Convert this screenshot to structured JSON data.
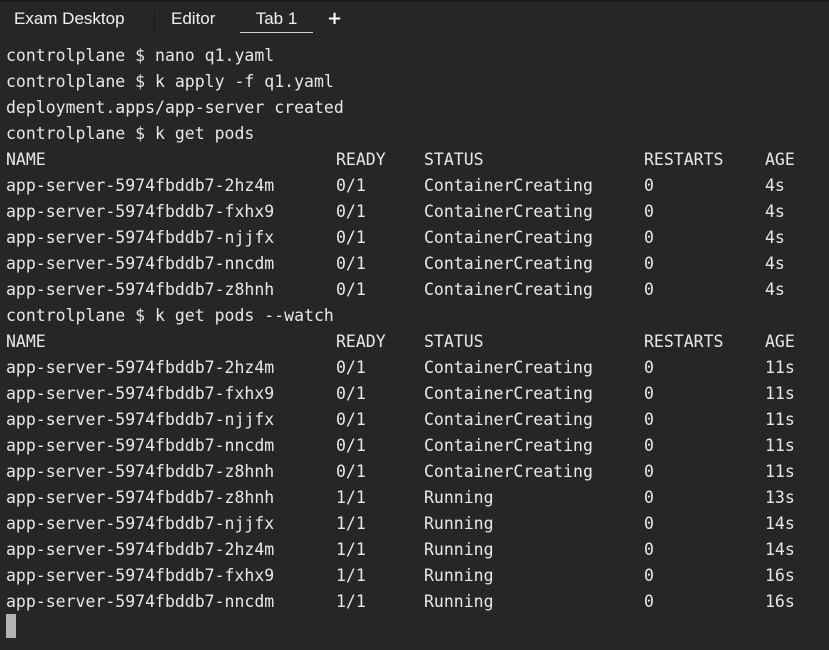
{
  "tabs": {
    "exam_desktop": "Exam Desktop",
    "editor": "Editor",
    "tab1": "Tab 1",
    "new_tab": "+"
  },
  "terminal": {
    "commands": [
      "controlplane $ nano q1.yaml",
      "controlplane $ k apply -f q1.yaml",
      "deployment.apps/app-server created",
      "controlplane $ k get pods",
      "controlplane $ k get pods --watch"
    ],
    "headers": [
      "NAME",
      "READY",
      "STATUS",
      "RESTARTS",
      "AGE"
    ],
    "get_pods_rows": [
      [
        "app-server-5974fbddb7-2hz4m",
        "0/1",
        "ContainerCreating",
        "0",
        "4s"
      ],
      [
        "app-server-5974fbddb7-fxhx9",
        "0/1",
        "ContainerCreating",
        "0",
        "4s"
      ],
      [
        "app-server-5974fbddb7-njjfx",
        "0/1",
        "ContainerCreating",
        "0",
        "4s"
      ],
      [
        "app-server-5974fbddb7-nncdm",
        "0/1",
        "ContainerCreating",
        "0",
        "4s"
      ],
      [
        "app-server-5974fbddb7-z8hnh",
        "0/1",
        "ContainerCreating",
        "0",
        "4s"
      ]
    ],
    "watch_rows": [
      [
        "app-server-5974fbddb7-2hz4m",
        "0/1",
        "ContainerCreating",
        "0",
        "11s"
      ],
      [
        "app-server-5974fbddb7-fxhx9",
        "0/1",
        "ContainerCreating",
        "0",
        "11s"
      ],
      [
        "app-server-5974fbddb7-njjfx",
        "0/1",
        "ContainerCreating",
        "0",
        "11s"
      ],
      [
        "app-server-5974fbddb7-nncdm",
        "0/1",
        "ContainerCreating",
        "0",
        "11s"
      ],
      [
        "app-server-5974fbddb7-z8hnh",
        "0/1",
        "ContainerCreating",
        "0",
        "11s"
      ],
      [
        "app-server-5974fbddb7-z8hnh",
        "1/1",
        "Running",
        "0",
        "13s"
      ],
      [
        "app-server-5974fbddb7-njjfx",
        "1/1",
        "Running",
        "0",
        "14s"
      ],
      [
        "app-server-5974fbddb7-2hz4m",
        "1/1",
        "Running",
        "0",
        "14s"
      ],
      [
        "app-server-5974fbddb7-fxhx9",
        "1/1",
        "Running",
        "0",
        "16s"
      ],
      [
        "app-server-5974fbddb7-nncdm",
        "1/1",
        "Running",
        "0",
        "16s"
      ]
    ]
  },
  "colors": {
    "background": "#262626",
    "text": "#e8e8e8",
    "cursor": "#b3b3b3"
  }
}
